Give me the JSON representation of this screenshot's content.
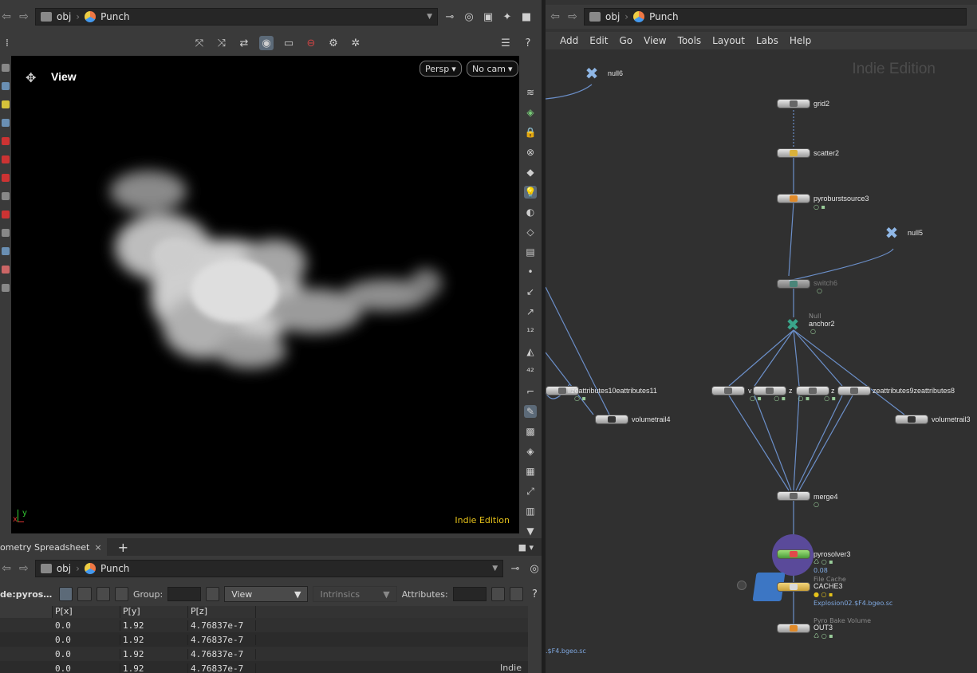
{
  "left": {
    "path": {
      "root": "obj",
      "network": "Punch"
    },
    "viewport": {
      "title": "View",
      "persp_button": "Persp",
      "cam_button": "No cam",
      "watermark": "Indie Edition",
      "axis_x": "x",
      "axis_y": "y"
    },
    "tab": {
      "label": "ometry Spreadsheet",
      "close": "×",
      "add": "+"
    },
    "spreadsheet": {
      "path": {
        "root": "obj",
        "network": "Punch"
      },
      "node_label": "de:pyros…",
      "group_label": "Group:",
      "view_combo": "View",
      "intrinsics_combo": "Intrinsics",
      "attributes_label": "Attributes:",
      "columns": [
        "P[x]",
        "P[y]",
        "P[z]"
      ],
      "rows": [
        [
          "0.0",
          "1.92",
          "4.76837e-7"
        ],
        [
          "0.0",
          "1.92",
          "4.76837e-7"
        ],
        [
          "0.0",
          "1.92",
          "4.76837e-7"
        ],
        [
          "0.0",
          "1.92",
          "4.76837e-7"
        ]
      ],
      "watermark": "Indie"
    }
  },
  "right": {
    "path": {
      "root": "obj",
      "network": "Punch"
    },
    "menu": [
      "Add",
      "Edit",
      "Go",
      "View",
      "Tools",
      "Layout",
      "Labs",
      "Help"
    ],
    "watermark": "Indie Edition",
    "nodes": {
      "null6": "null6",
      "grid2": "grid2",
      "scatter2": "scatter2",
      "pyroburstsource3": "pyroburstsource3",
      "null5": "null5",
      "switch6": "switch6",
      "anchor2_type": "Null",
      "anchor2": "anchor2",
      "left_group_label": "ſizeattributes10eattributes11",
      "volumetrail4": "volumetrail4",
      "va": "v",
      "vb": "z",
      "vc": "z",
      "vd": "zeattributes9zeattributes8",
      "volumetrail3": "volumetrail3",
      "merge4": "merge4",
      "pyrosolver3": "pyrosolver3",
      "pyrosolver3_value": "0.08",
      "cache_type": "File Cache",
      "cache": "CACHE3",
      "cache_path": "Explosion02.$F4.bgeo.sc",
      "out_type": "Pyro Bake Volume",
      "out": "OUT3",
      "left_path": ".$F4.bgeo.sc"
    }
  }
}
